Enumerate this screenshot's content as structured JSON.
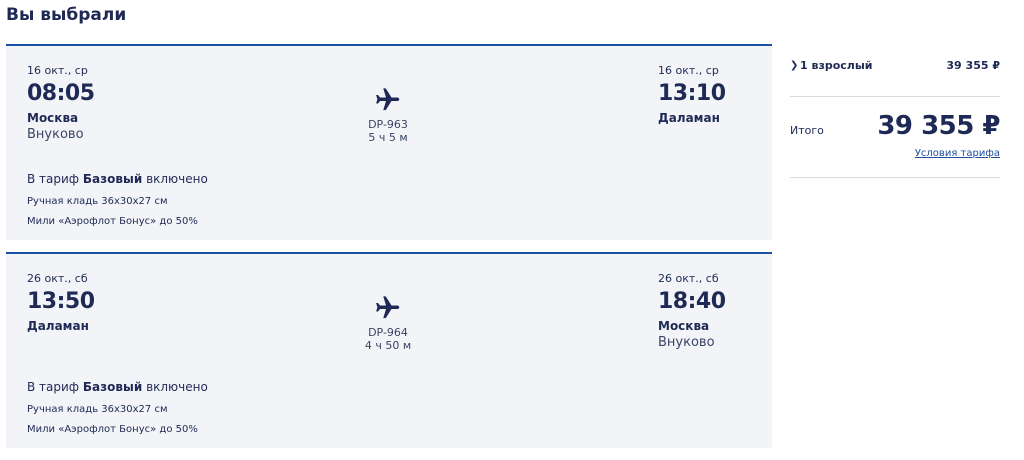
{
  "page": {
    "title": "Вы выбрали"
  },
  "flights": [
    {
      "departure": {
        "date": "16 окт., ср",
        "time": "08:05",
        "city": "Москва",
        "airport": "Внуково"
      },
      "flight_number": "DP-963",
      "duration": "5 ч 5 м",
      "arrival": {
        "date": "16 окт., ср",
        "time": "13:10",
        "city": "Даламан",
        "airport": ""
      },
      "tariff": {
        "prefix": "В тариф",
        "name": "Базовый",
        "suffix": "включено"
      },
      "features": [
        "Ручная кладь 36x30x27 см",
        "Мили «Аэрофлот Бонус» до 50%"
      ]
    },
    {
      "departure": {
        "date": "26 окт., сб",
        "time": "13:50",
        "city": "Даламан",
        "airport": ""
      },
      "flight_number": "DP-964",
      "duration": "4 ч 50 м",
      "arrival": {
        "date": "26 окт., сб",
        "time": "18:40",
        "city": "Москва",
        "airport": "Внуково"
      },
      "tariff": {
        "prefix": "В тариф",
        "name": "Базовый",
        "suffix": "включено"
      },
      "features": [
        "Ручная кладь 36x30x27 см",
        "Мили «Аэрофлот Бонус» до 50%"
      ]
    }
  ],
  "summary": {
    "passengers_label": "1 взрослый",
    "passengers_price": "39 355 ₽",
    "total_label": "Итого",
    "total_price": "39 355 ₽",
    "tariff_conditions_link": "Условия тарифа"
  },
  "icons": {
    "expand": "chevron-right-icon",
    "flight": "airplane-icon"
  },
  "colors": {
    "text": "#1e2a55",
    "accent": "#1e4fa0",
    "card_bg": "#f2f4f7"
  }
}
